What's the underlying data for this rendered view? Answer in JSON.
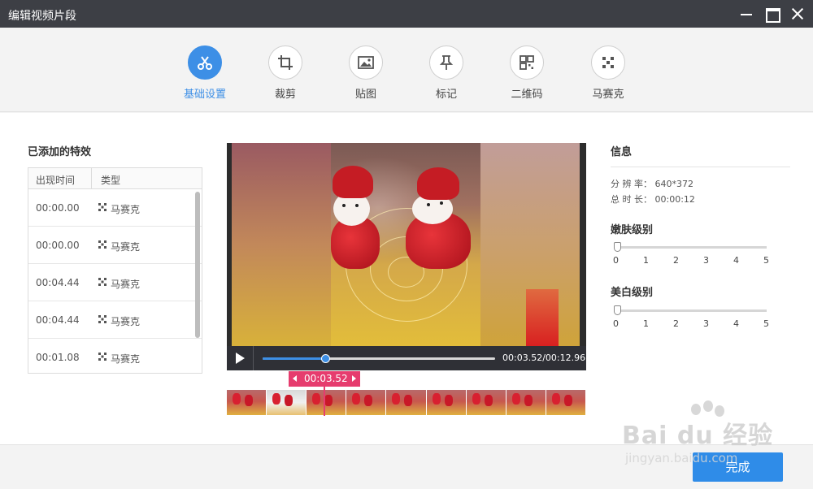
{
  "window": {
    "title": "编辑视频片段"
  },
  "toolbar": {
    "tools": [
      {
        "label": "基础设置",
        "icon": "scissors-icon",
        "active": true
      },
      {
        "label": "裁剪",
        "icon": "crop-icon"
      },
      {
        "label": "贴图",
        "icon": "image-icon"
      },
      {
        "label": "标记",
        "icon": "pin-icon"
      },
      {
        "label": "二维码",
        "icon": "qrcode-icon"
      },
      {
        "label": "马赛克",
        "icon": "mosaic-icon"
      }
    ]
  },
  "effects": {
    "title": "已添加的特效",
    "columns": [
      "出现时间",
      "类型"
    ],
    "rows": [
      {
        "time": "00:00.00",
        "type": "马赛克"
      },
      {
        "time": "00:00.00",
        "type": "马赛克"
      },
      {
        "time": "00:04.44",
        "type": "马赛克"
      },
      {
        "time": "00:04.44",
        "type": "马赛克"
      },
      {
        "time": "00:01.08",
        "type": "马赛克"
      }
    ]
  },
  "player": {
    "time_display": "00:03.52/00:12.96",
    "progress": 0.27,
    "marker_time": "00:03.52"
  },
  "info": {
    "title": "信息",
    "resolution_label": "分 辨 率：",
    "resolution_value": "640*372",
    "duration_label": "总 时 长：",
    "duration_value": "00:00:12",
    "smooth_label": "嫩肤级别",
    "smooth_value": 0,
    "whiten_label": "美白级别",
    "whiten_value": 0,
    "ticks": [
      "0",
      "1",
      "2",
      "3",
      "4",
      "5"
    ]
  },
  "footer": {
    "done_label": "完成"
  },
  "watermark": {
    "brand": "Bai du 经验",
    "url": "jingyan.baidu.com"
  },
  "colors": {
    "accent": "#3d8fe6",
    "marker": "#e63c6e",
    "titlebar": "#3d3f45"
  }
}
